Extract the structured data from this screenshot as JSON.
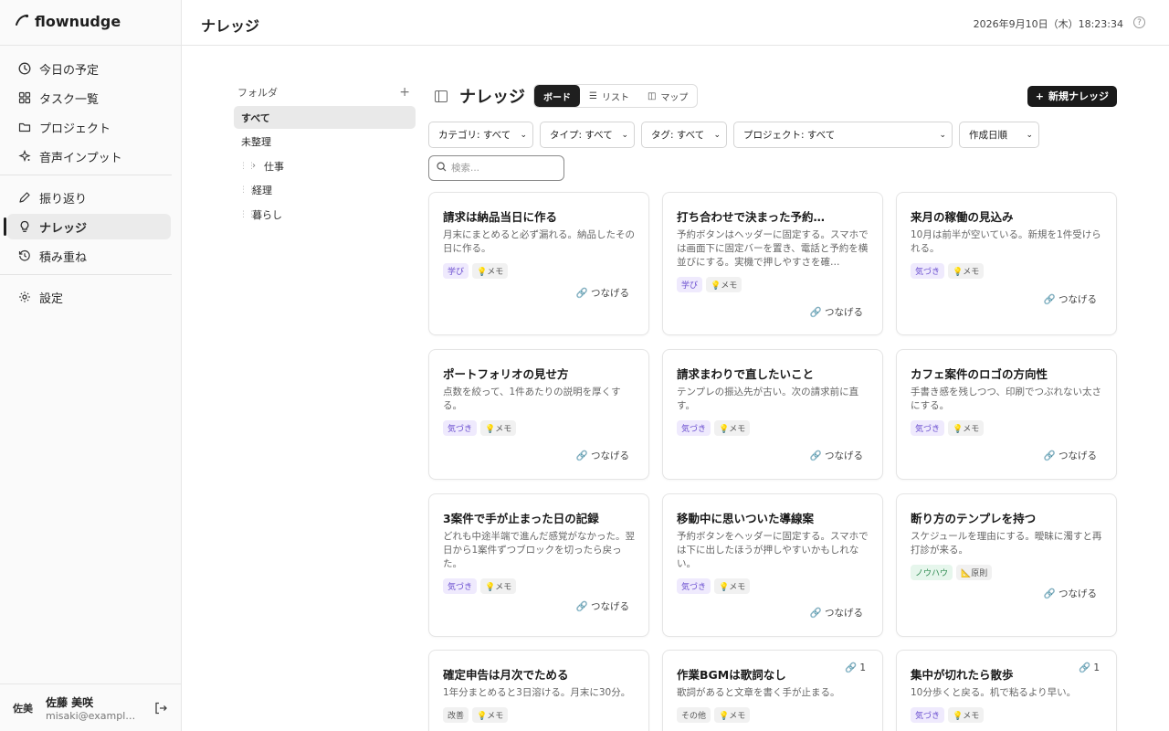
{
  "app": {
    "name": "flownudge"
  },
  "sidebar": {
    "items": [
      {
        "label": "今日の予定",
        "icon": "clock-icon"
      },
      {
        "label": "タスク一覧",
        "icon": "grid-icon"
      },
      {
        "label": "プロジェクト",
        "icon": "folder-icon"
      },
      {
        "label": "音声インプット",
        "icon": "sparkle-icon"
      },
      {
        "label": "振り返り",
        "icon": "pencil-icon"
      },
      {
        "label": "ナレッジ",
        "icon": "bulb-icon",
        "active": true
      },
      {
        "label": "積み重ね",
        "icon": "history-icon"
      },
      {
        "label": "設定",
        "icon": "gear-icon"
      }
    ],
    "user": {
      "avatar": "佐美",
      "name": "佐藤 美咲",
      "email": "misaki@example.…"
    }
  },
  "header": {
    "title": "ナレッジ",
    "datetime": "2026年9月10日（木）18:23:34",
    "help": "?"
  },
  "folders": {
    "heading": "フォルダ",
    "add": "+",
    "items": [
      {
        "label": "すべて",
        "active": true
      },
      {
        "label": "未整理"
      },
      {
        "label": "仕事",
        "expandable": true
      },
      {
        "label": "経理"
      },
      {
        "label": "暮らし"
      }
    ]
  },
  "main": {
    "title": "ナレッジ",
    "tabs": [
      {
        "label": "ボード",
        "active": true
      },
      {
        "label": "リスト"
      },
      {
        "label": "マップ"
      }
    ],
    "new_button": "新規ナレッジ",
    "filters": [
      {
        "label": "カテゴリ: すべて"
      },
      {
        "label": "タイプ: すべて"
      },
      {
        "label": "タグ: すべて"
      },
      {
        "label": "プロジェクト: すべて"
      },
      {
        "label": "作成日順"
      }
    ],
    "search_placeholder": "検索..."
  },
  "connect_label": "つなげる",
  "cards": [
    {
      "title": "請求は納品当日に作る",
      "body": "月末にまとめると必ず漏れる。納品したその日に作る。",
      "category": "学び",
      "type": "メモ"
    },
    {
      "title": "打ち合わせで決まった予約…",
      "body": "予約ボタンはヘッダーに固定する。スマホでは画面下に固定バーを置き、電話と予約を横並びにする。実機で押しやすさを確…",
      "category": "学び",
      "type": "メモ"
    },
    {
      "title": "来月の稼働の見込み",
      "body": "10月は前半が空いている。新規を1件受けられる。",
      "category": "気づき",
      "type": "メモ"
    },
    {
      "title": "ポートフォリオの見せ方",
      "body": "点数を絞って、1件あたりの説明を厚くする。",
      "category": "気づき",
      "type": "メモ"
    },
    {
      "title": "請求まわりで直したいこと",
      "body": "テンプレの振込先が古い。次の請求前に直す。",
      "category": "気づき",
      "type": "メモ"
    },
    {
      "title": "カフェ案件のロゴの方向性",
      "body": "手書き感を残しつつ、印刷でつぶれない太さにする。",
      "category": "気づき",
      "type": "メモ"
    },
    {
      "title": "3案件で手が止まった日の記録",
      "body": "どれも中途半端で進んだ感覚がなかった。翌日から1案件ずつブロックを切ったら戻った。",
      "category": "気づき",
      "type": "メモ"
    },
    {
      "title": "移動中に思いついた導線案",
      "body": "予約ボタンをヘッダーに固定する。スマホでは下に出したほうが押しやすいかもしれない。",
      "category": "気づき",
      "type": "メモ"
    },
    {
      "title": "断り方のテンプレを持つ",
      "body": "スケジュールを理由にする。曖昧に濁すと再打診が来る。",
      "category": "ノウハウ",
      "type": "原則"
    },
    {
      "title": "確定申告は月次でためる",
      "body": "1年分まとめると3日溶ける。月末に30分。",
      "category": "改善",
      "type": "メモ"
    },
    {
      "title": "作業BGMは歌詞なし",
      "body": "歌詞があると文章を書く手が止まる。",
      "category": "その他",
      "type": "メモ",
      "links": "1"
    },
    {
      "title": "集中が切れたら散歩",
      "body": "10分歩くと戻る。机で粘るより早い。",
      "category": "気づき",
      "type": "メモ",
      "links": "1"
    }
  ]
}
